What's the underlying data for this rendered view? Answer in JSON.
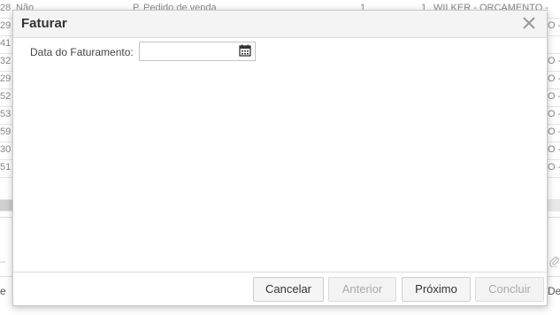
{
  "background": {
    "rows": [
      {
        "n": "28",
        "flag": "Não",
        "type": "P. Pedido de venda",
        "q1": "1",
        "q2": "1",
        "client": "WILKER - ORCAMENTO -"
      },
      {
        "n": "29",
        "flag": "",
        "type": "",
        "q1": "",
        "q2": "",
        "client": "",
        "tail": "O -"
      },
      {
        "n": "41",
        "flag": "",
        "type": "",
        "q1": "",
        "q2": "",
        "client": "",
        "tail": ""
      },
      {
        "n": "32",
        "flag": "",
        "type": "",
        "q1": "",
        "q2": "",
        "client": "",
        "tail": "O -"
      },
      {
        "n": "29",
        "flag": "",
        "type": "",
        "q1": "",
        "q2": "",
        "client": "",
        "tail": "O -"
      },
      {
        "n": "52",
        "flag": "",
        "type": "",
        "q1": "",
        "q2": "",
        "client": "",
        "tail": "O -"
      },
      {
        "n": "53",
        "flag": "",
        "type": "",
        "q1": "",
        "q2": "",
        "client": "",
        "tail": "O -"
      },
      {
        "n": "59",
        "flag": "",
        "type": "",
        "q1": "",
        "q2": "",
        "client": "",
        "tail": "O -"
      },
      {
        "n": "30",
        "flag": "",
        "type": "",
        "q1": "",
        "q2": "",
        "client": "",
        "tail": "O -"
      },
      {
        "n": "51",
        "flag": "",
        "type": "",
        "q1": "",
        "q2": "",
        "client": "",
        "tail": "O -"
      }
    ],
    "footer_left": "e",
    "footer_right": "De",
    "dash": "–"
  },
  "modal": {
    "title": "Faturar",
    "close_icon": "close-icon",
    "field_label": "Data do Faturamento:",
    "date_value": "",
    "calendar_icon": "calendar-icon",
    "buttons": {
      "cancel": "Cancelar",
      "previous": "Anterior",
      "next": "Próximo",
      "finish": "Concluir"
    }
  }
}
